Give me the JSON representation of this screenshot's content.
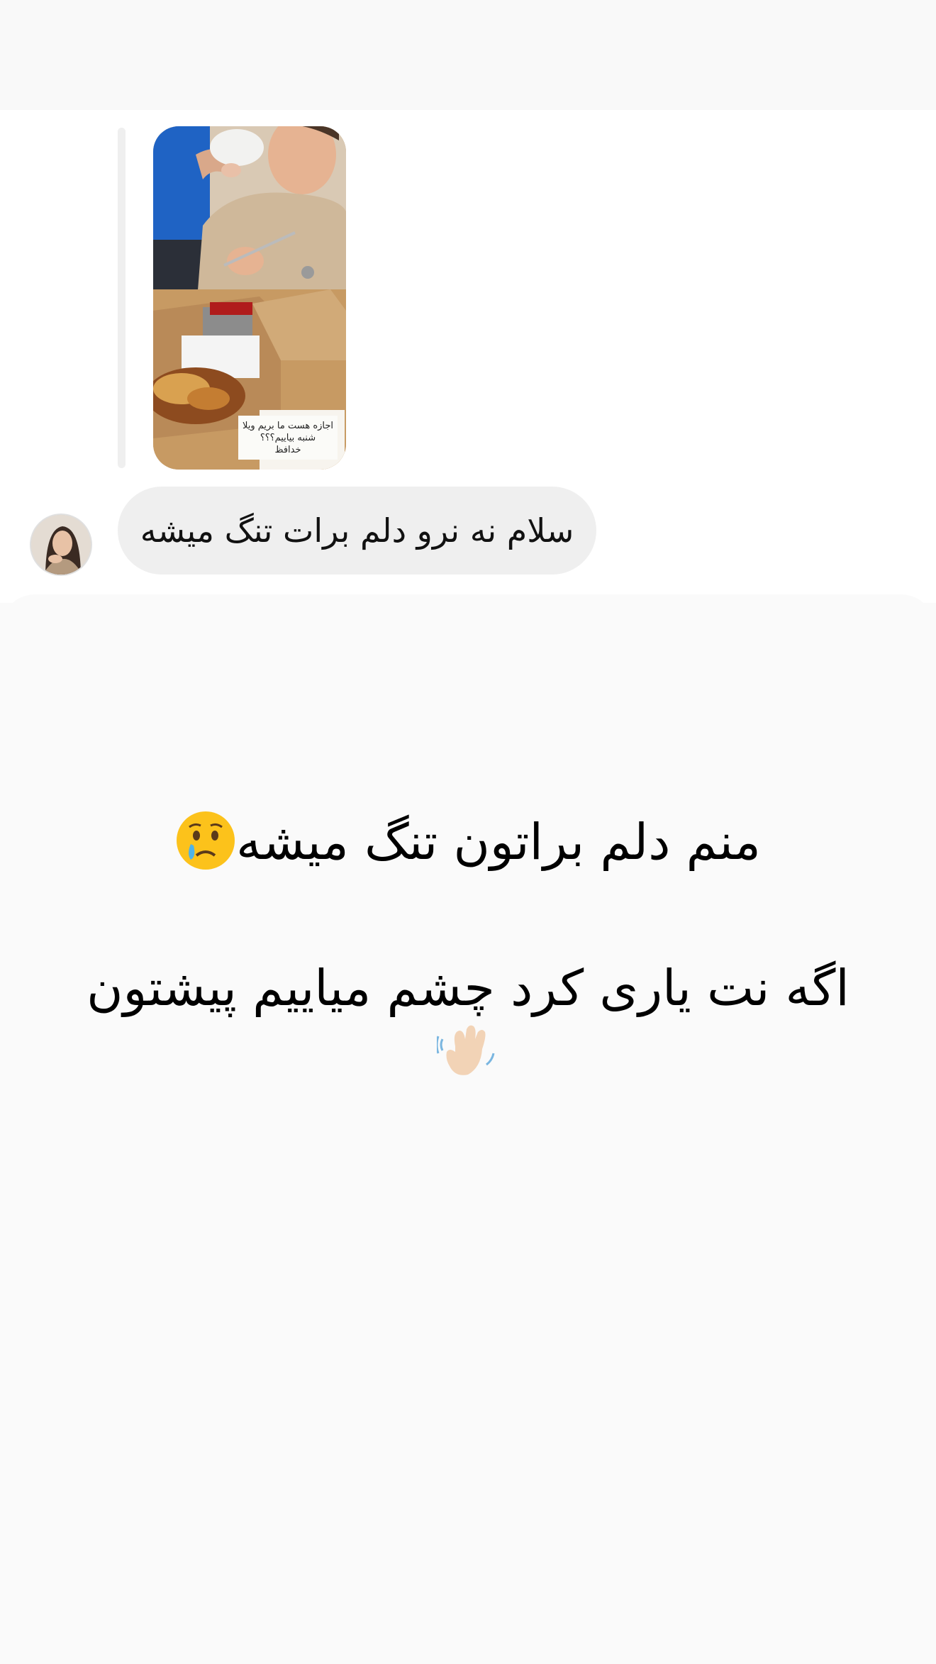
{
  "story": {
    "caption_line1": "اجازه هست ما بریم ویلا",
    "caption_line2": "شنبه بیاییم؟؟؟",
    "caption_line3": "خدافظ"
  },
  "message": {
    "text": "سلام نه نرو دلم برات تنگ میشه"
  },
  "overlay": {
    "line1": "منم دلم براتون تنگ میشه",
    "line1_emoji": "crying-face-icon",
    "line2": "اگه نت یاری کرد چشم میاییم پیشتون",
    "line2_emoji": "waving-hand-icon"
  },
  "colors": {
    "background": "#fafafa",
    "bubble": "#efefef",
    "reply_line": "#efefef"
  }
}
